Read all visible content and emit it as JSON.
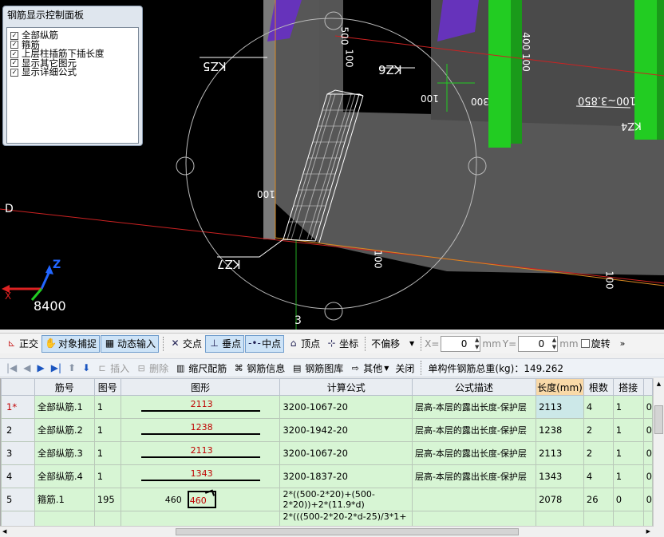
{
  "viewport": {
    "labels": {
      "kz5": "KZ5",
      "kz6": "KZ6",
      "kz7": "KZ7",
      "kz4": "KZ4",
      "dim_500": "500",
      "dim_100a": "100",
      "dim_400100": "400 100",
      "dim_100b": "100",
      "dim_300": "300",
      "dim_range": "100~3.850",
      "dim_100c": "100",
      "dim_100d": "100",
      "dim_100e": "100",
      "axis_d": "D",
      "axis_3": "3",
      "coord": "8400",
      "axis_z": "Z",
      "axis_x": "X"
    },
    "colors": {
      "green": "#22cc22",
      "purple": "#6633bb",
      "grid_red": "#cc2222",
      "gray": "#6e6e6e"
    }
  },
  "control_panel": {
    "title": "钢筋显示控制面板",
    "items": [
      "全部纵筋",
      "箍筋",
      "上层柱插筋下插长度",
      "显示其它图元",
      "显示详细公式"
    ]
  },
  "toolbar1": {
    "orthogonal": "正交",
    "object_snap": "对象捕捉",
    "dynamic_input": "动态输入",
    "intersection": "交点",
    "perpendicular": "垂点",
    "midpoint": "中点",
    "vertex": "顶点",
    "coordinate": "坐标",
    "offset_select": "不偏移",
    "x_label": "X=",
    "x_value": "0",
    "mm1": "mm",
    "y_label": "Y=",
    "y_value": "0",
    "mm2": "mm",
    "rotate": "旋转",
    "more": "»"
  },
  "toolbar2": {
    "insert": "插入",
    "delete": "删除",
    "scale_rebar": "缩尺配筋",
    "rebar_info": "钢筋信息",
    "rebar_library": "钢筋图库",
    "other": "其他",
    "close": "关闭",
    "total_weight": "单构件钢筋总重(kg)：149.262"
  },
  "grid": {
    "headers": [
      "筋号",
      "图号",
      "图形",
      "计算公式",
      "公式描述",
      "长度(mm)",
      "根数",
      "搭接"
    ],
    "rows": [
      {
        "rn": "1*",
        "name": "全部纵筋.1",
        "fig": "1",
        "shape": "2113",
        "formula": "3200-1067-20",
        "desc": "层高-本层的露出长度-保护层",
        "length": "2113",
        "count": "4",
        "lap": "1",
        "extra": "0"
      },
      {
        "rn": "2",
        "name": "全部纵筋.2",
        "fig": "1",
        "shape": "1238",
        "formula": "3200-1942-20",
        "desc": "层高-本层的露出长度-保护层",
        "length": "1238",
        "count": "2",
        "lap": "1",
        "extra": "0"
      },
      {
        "rn": "3",
        "name": "全部纵筋.3",
        "fig": "1",
        "shape": "2113",
        "formula": "3200-1067-20",
        "desc": "层高-本层的露出长度-保护层",
        "length": "2113",
        "count": "2",
        "lap": "1",
        "extra": "0"
      },
      {
        "rn": "4",
        "name": "全部纵筋.4",
        "fig": "1",
        "shape": "1343",
        "formula": "3200-1837-20",
        "desc": "层高-本层的露出长度-保护层",
        "length": "1343",
        "count": "4",
        "lap": "1",
        "extra": "0"
      },
      {
        "rn": "5",
        "name": "箍筋.1",
        "fig": "195",
        "shape_left": "460",
        "shape_box": "460",
        "formula": "2*((500-2*20)+(500-2*20))+2*(11.9*d)",
        "desc": "",
        "length": "2078",
        "count": "26",
        "lap": "0",
        "extra": "0"
      },
      {
        "rn": "",
        "name": "",
        "fig": "",
        "shape": "",
        "formula": "2*(((500-2*20-2*d-25)/3*1+",
        "desc": "",
        "length": "",
        "count": "",
        "lap": "",
        "extra": ""
      }
    ]
  }
}
